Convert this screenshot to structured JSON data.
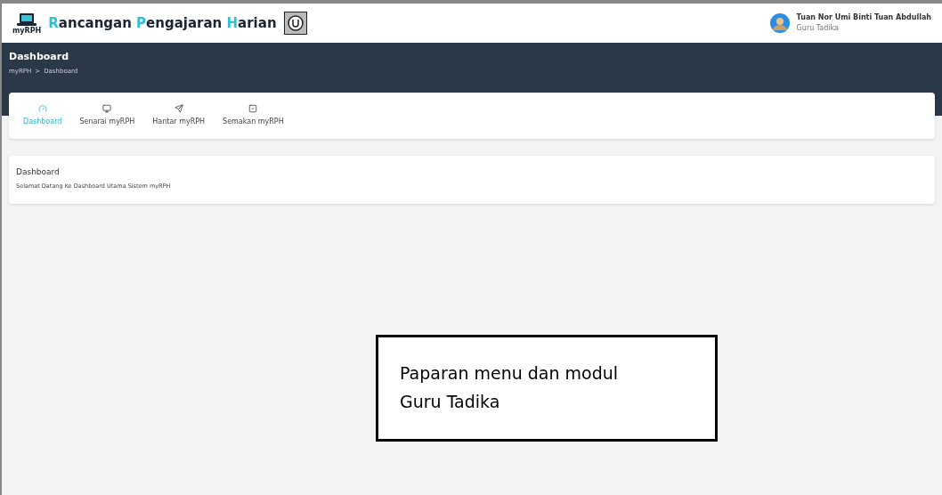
{
  "header": {
    "logo_caption": "myRPH",
    "title": "Rancangan Pengajaran Harian",
    "user": {
      "name": "Tuan Nor Umi Binti Tuan Abdullah",
      "role": "Guru Tadika"
    }
  },
  "page": {
    "title": "Dashboard",
    "breadcrumb": [
      "myRPH",
      "Dashboard"
    ],
    "separator": ">"
  },
  "tabs": [
    {
      "label": "Dashboard",
      "selected": true
    },
    {
      "label": "Senarai myRPH",
      "selected": false
    },
    {
      "label": "Hantar myRPH",
      "selected": false
    },
    {
      "label": "Semakan myRPH",
      "selected": false
    }
  ],
  "card": {
    "title": "Dashboard",
    "text": "Selamat Datang Ke Dashboard Utama Sistem myRPH"
  },
  "callout": {
    "lines": [
      "Paparan menu dan modul",
      "Guru Tadika"
    ]
  }
}
